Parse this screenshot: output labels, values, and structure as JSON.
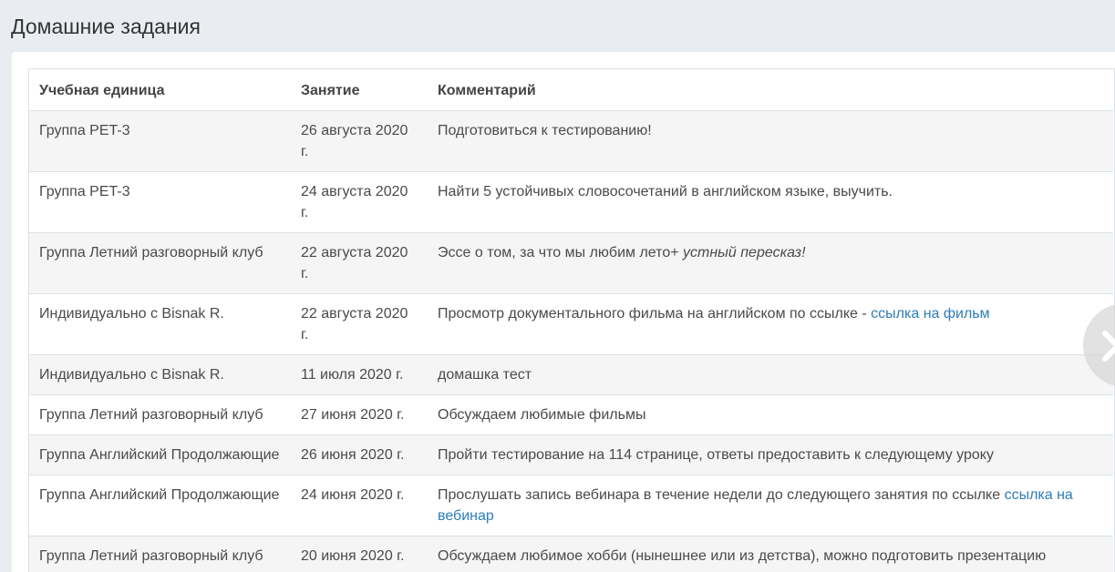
{
  "page": {
    "title": "Домашние задания"
  },
  "table": {
    "headers": {
      "unit": "Учебная единица",
      "lesson": "Занятие",
      "comment": "Комментарий"
    },
    "rows": [
      {
        "unit": "Группа PET-3",
        "lesson": "26 августа 2020 г.",
        "comment": "Подготовиться к тестированию!",
        "comment_italic": "",
        "link": ""
      },
      {
        "unit": "Группа PET-3",
        "lesson": "24 августа 2020 г.",
        "comment": "Найти 5 устойчивых словосочетаний в английском языке, выучить.",
        "comment_italic": "",
        "link": ""
      },
      {
        "unit": "Группа Летний разговорный клуб",
        "lesson": "22 августа 2020 г.",
        "comment": "Эссе о том, за что мы любим лето+ ",
        "comment_italic": "устный пересказ!",
        "link": ""
      },
      {
        "unit": "Индивидуально с Bisnak R.",
        "lesson": "22 августа 2020 г.",
        "comment": "Просмотр документального фильма на английском по ссылке - ",
        "comment_italic": "",
        "link": "ссылка на фильм"
      },
      {
        "unit": "Индивидуально с Bisnak R.",
        "lesson": "11 июля 2020 г.",
        "comment": "домашка тест",
        "comment_italic": "",
        "link": ""
      },
      {
        "unit": "Группа Летний разговорный клуб",
        "lesson": "27 июня 2020 г.",
        "comment": "Обсуждаем любимые фильмы",
        "comment_italic": "",
        "link": ""
      },
      {
        "unit": "Группа Английский Продолжающие",
        "lesson": "26 июня 2020 г.",
        "comment": "Пройти тестирование на 114 странице, ответы предоставить к следующему уроку",
        "comment_italic": "",
        "link": ""
      },
      {
        "unit": "Группа Английский Продолжающие",
        "lesson": "24 июня 2020 г.",
        "comment": "Прослушать запись вебинара в течение недели до следующего занятия по ссылке ",
        "comment_italic": "",
        "link": "ссылка на вебинар"
      },
      {
        "unit": "Группа Летний разговорный клуб",
        "lesson": "20 июня 2020 г.",
        "comment": "Обсуждаем любимое хобби (нынешнее или из детства), можно подготовить презентацию",
        "comment_italic": "",
        "link": ""
      }
    ]
  },
  "icons": {
    "next": "chevron-right-icon"
  }
}
